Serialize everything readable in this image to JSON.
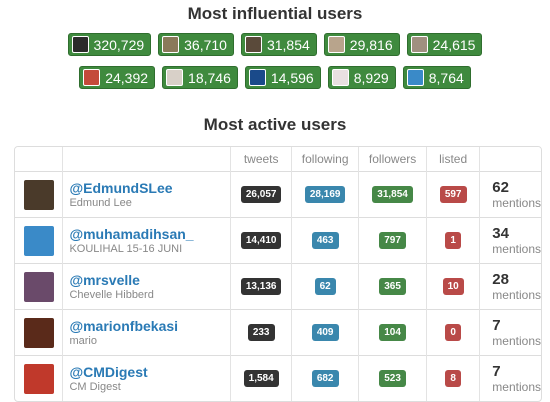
{
  "influential": {
    "title": "Most influential users",
    "row1": [
      {
        "value": "320,729",
        "avatar_color": "#2b2b2b"
      },
      {
        "value": "36,710",
        "avatar_color": "#8a7a5a"
      },
      {
        "value": "31,854",
        "avatar_color": "#5a4a3a"
      },
      {
        "value": "29,816",
        "avatar_color": "#b8a48c"
      },
      {
        "value": "24,615",
        "avatar_color": "#a09080"
      }
    ],
    "row2": [
      {
        "value": "24,392",
        "avatar_color": "#c44a3a"
      },
      {
        "value": "18,746",
        "avatar_color": "#d8d0c8"
      },
      {
        "value": "14,596",
        "avatar_color": "#1a4a8a"
      },
      {
        "value": "8,929",
        "avatar_color": "#e8e0e0"
      },
      {
        "value": "8,764",
        "avatar_color": "#3a8ac8"
      }
    ]
  },
  "active": {
    "title": "Most active users",
    "headers": {
      "tweets": "tweets",
      "following": "following",
      "followers": "followers",
      "listed": "listed"
    },
    "mentions_label": "mentions",
    "rows": [
      {
        "handle": "@EdmundSLee",
        "name": "Edmund Lee",
        "tweets": "26,057",
        "following": "28,169",
        "followers": "31,854",
        "listed": "597",
        "mentions": "62",
        "avatar_color": "#4a3a2a"
      },
      {
        "handle": "@muhamadihsan_",
        "name": "KOULIHAL 15-16 JUNI",
        "tweets": "14,410",
        "following": "463",
        "followers": "797",
        "listed": "1",
        "mentions": "34",
        "avatar_color": "#3a8ac8"
      },
      {
        "handle": "@mrsvelle",
        "name": "Chevelle Hibberd",
        "tweets": "13,136",
        "following": "62",
        "followers": "365",
        "listed": "10",
        "mentions": "28",
        "avatar_color": "#6a4a6a"
      },
      {
        "handle": "@marionfbekasi",
        "name": "mario",
        "tweets": "233",
        "following": "409",
        "followers": "104",
        "listed": "0",
        "mentions": "7",
        "avatar_color": "#5a2a1a"
      },
      {
        "handle": "@CMDigest",
        "name": "CM Digest",
        "tweets": "1,584",
        "following": "682",
        "followers": "523",
        "listed": "8",
        "mentions": "7",
        "avatar_color": "#c0392b"
      }
    ]
  }
}
